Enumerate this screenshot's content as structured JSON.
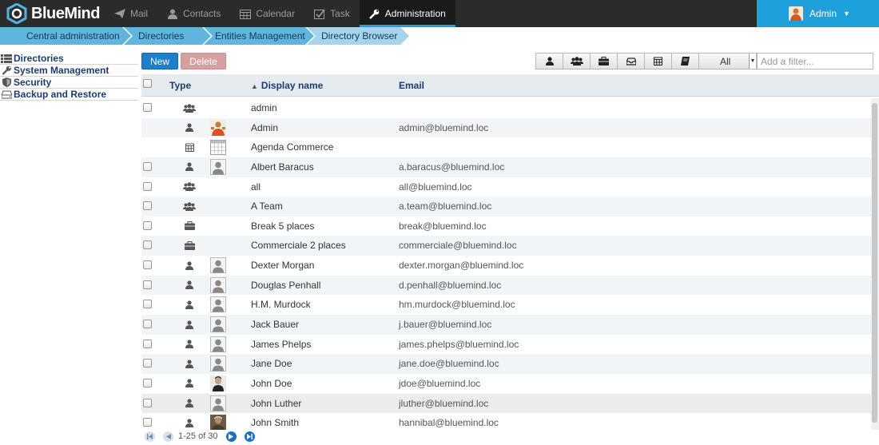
{
  "app": {
    "name": "BlueMind"
  },
  "nav": [
    {
      "label": "Mail",
      "icon": "paper-plane-icon",
      "active": false
    },
    {
      "label": "Contacts",
      "icon": "user-icon",
      "active": false
    },
    {
      "label": "Calendar",
      "icon": "calendar-icon",
      "active": false
    },
    {
      "label": "Task",
      "icon": "checkbox-icon",
      "active": false
    },
    {
      "label": "Administration",
      "icon": "wrench-icon",
      "active": true
    }
  ],
  "user": {
    "name": "Admin",
    "caret": "▼"
  },
  "breadcrumb": [
    "Central administration",
    "Directories",
    "Entities Management",
    "Directory Browser"
  ],
  "sidebar": [
    {
      "label": "Directories",
      "icon": "list-icon"
    },
    {
      "label": "System Management",
      "icon": "wrench-icon"
    },
    {
      "label": "Security",
      "icon": "shield-icon"
    },
    {
      "label": "Backup and Restore",
      "icon": "drive-icon"
    }
  ],
  "toolbar": {
    "new_label": "New",
    "delete_label": "Delete"
  },
  "filter": {
    "select_value": "All",
    "placeholder": "Add a filter..."
  },
  "table": {
    "columns": {
      "type": "Type",
      "name": "Display name",
      "email": "Email"
    },
    "sort_indicator": "▲",
    "rows": [
      {
        "type": "group",
        "thumb": "",
        "name": "admin",
        "email": "",
        "checkbox": true
      },
      {
        "type": "user",
        "thumb": "admin-photo",
        "name": "Admin",
        "email": "admin@bluemind.loc",
        "checkbox": false
      },
      {
        "type": "calendar",
        "thumb": "calendar",
        "name": "Agenda Commerce",
        "email": "",
        "checkbox": false
      },
      {
        "type": "user",
        "thumb": "placeholder",
        "name": "Albert Baracus",
        "email": "a.baracus@bluemind.loc",
        "checkbox": true
      },
      {
        "type": "group",
        "thumb": "",
        "name": "all",
        "email": "all@bluemind.loc",
        "checkbox": true
      },
      {
        "type": "group",
        "thumb": "",
        "name": "A Team",
        "email": "a.team@bluemind.loc",
        "checkbox": true
      },
      {
        "type": "resource",
        "thumb": "",
        "name": "Break 5 places",
        "email": "break@bluemind.loc",
        "checkbox": true
      },
      {
        "type": "resource",
        "thumb": "",
        "name": "Commerciale 2 places",
        "email": "commerciale@bluemind.loc",
        "checkbox": true
      },
      {
        "type": "user",
        "thumb": "placeholder",
        "name": "Dexter Morgan",
        "email": "dexter.morgan@bluemind.loc",
        "checkbox": true
      },
      {
        "type": "user",
        "thumb": "placeholder",
        "name": "Douglas Penhall",
        "email": "d.penhall@bluemind.loc",
        "checkbox": true
      },
      {
        "type": "user",
        "thumb": "placeholder",
        "name": "H.M. Murdock",
        "email": "hm.murdock@bluemind.loc",
        "checkbox": true
      },
      {
        "type": "user",
        "thumb": "placeholder",
        "name": "Jack Bauer",
        "email": "j.bauer@bluemind.loc",
        "checkbox": true
      },
      {
        "type": "user",
        "thumb": "placeholder",
        "name": "James Phelps",
        "email": "james.phelps@bluemind.loc",
        "checkbox": true
      },
      {
        "type": "user",
        "thumb": "placeholder",
        "name": "Jane Doe",
        "email": "jane.doe@bluemind.loc",
        "checkbox": true
      },
      {
        "type": "user",
        "thumb": "photo-dark",
        "name": "John Doe",
        "email": "jdoe@bluemind.loc",
        "checkbox": true
      },
      {
        "type": "user",
        "thumb": "placeholder",
        "name": "John Luther",
        "email": "jluther@bluemind.loc",
        "checkbox": true
      },
      {
        "type": "user",
        "thumb": "photo-brown",
        "name": "John Smith",
        "email": "hannibal@bluemind.loc",
        "checkbox": true
      }
    ]
  },
  "pager": {
    "text": "1-25 of 30"
  },
  "colors": {
    "topbar": "#2b2b2b",
    "accent": "#1ea0db",
    "breadcrumb": "#5fb5de",
    "header_text": "#1b3d6e",
    "new_button": "#1e7fcb",
    "delete_button": "#d7a0a0"
  }
}
